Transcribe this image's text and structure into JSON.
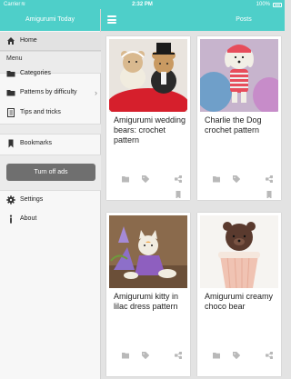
{
  "status_bar": {
    "carrier": "Carrier",
    "time": "2:32 PM",
    "battery": "100%"
  },
  "sidebar": {
    "title": "Amigurumi Today",
    "home_label": "Home",
    "menu_heading": "Menu",
    "items": [
      {
        "label": "Categories",
        "icon": "folder-icon"
      },
      {
        "label": "Patterns by difficulty",
        "icon": "folder-icon"
      },
      {
        "label": "Tips and tricks",
        "icon": "notebook-icon"
      }
    ],
    "bookmarks_label": "Bookmarks",
    "turn_off_ads_label": "Turn off ads",
    "settings_label": "Settings",
    "about_label": "About"
  },
  "header": {
    "title": "Posts"
  },
  "posts": [
    {
      "title": "Amigurumi wedding bears: crochet pattern"
    },
    {
      "title": "Charlie the Dog crochet pattern"
    },
    {
      "title": "Amigurumi kitty in lilac dress pattern"
    },
    {
      "title": "Amigurumi creamy choco bear"
    }
  ],
  "colors": {
    "accent": "#4ecfc9",
    "button": "#6f6f6f"
  }
}
